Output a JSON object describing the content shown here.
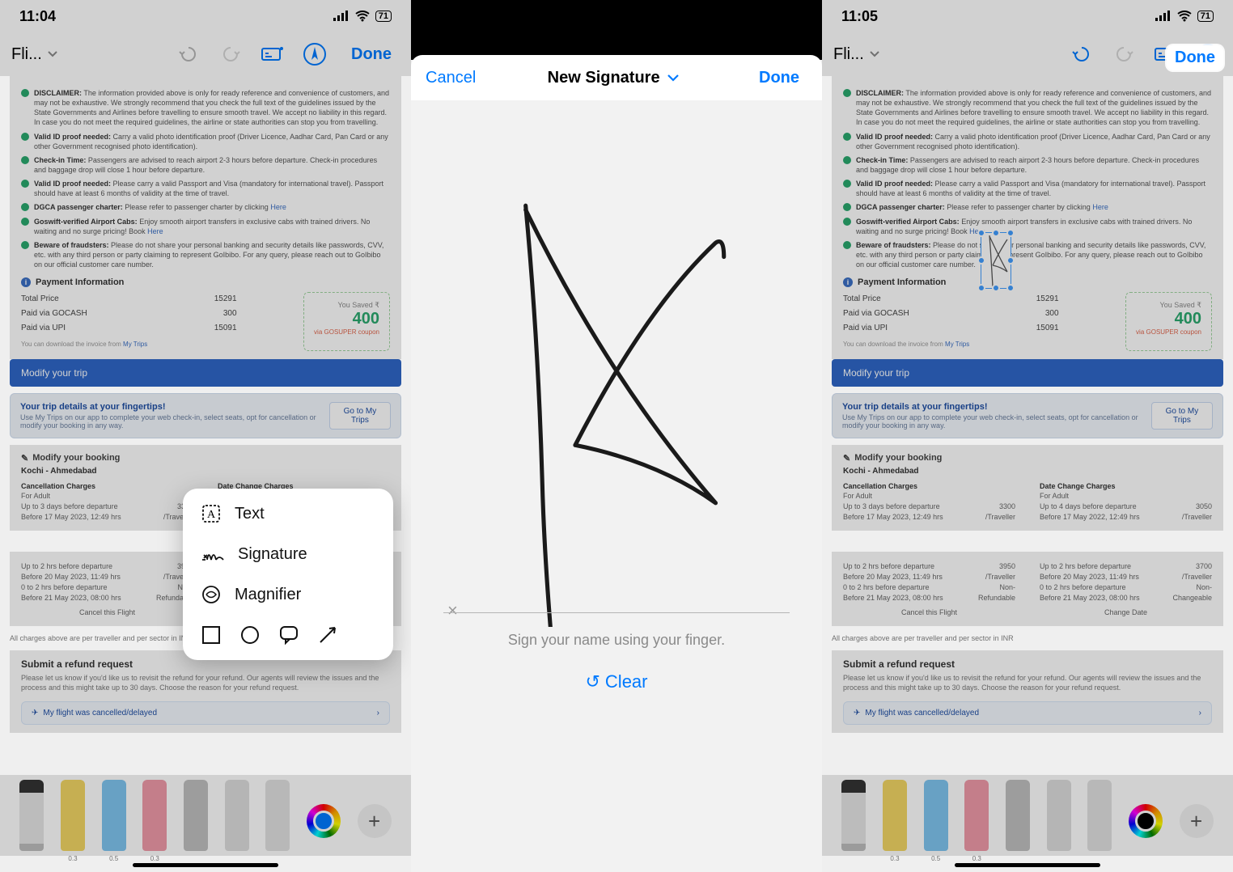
{
  "screen1": {
    "time": "11:04",
    "battery": "71",
    "file_title": "Fli...",
    "done": "Done",
    "doc": {
      "b1_t": "DISCLAIMER:",
      "b1": "The information provided above is only for ready reference and convenience of customers, and may not be exhaustive. We strongly recommend that you check the full text of the guidelines issued by the State Governments and Airlines before travelling to ensure smooth travel. We accept no liability in this regard. In case you do not meet the required guidelines, the airline or state authorities can stop you from travelling.",
      "b2_t": "Valid ID proof needed:",
      "b2": "Carry a valid photo identification proof (Driver Licence, Aadhar Card, Pan Card or any other Government recognised photo identification).",
      "b3_t": "Check-in Time:",
      "b3": "Passengers are advised to reach airport 2-3 hours before departure. Check-in procedures and baggage drop will close 1 hour before departure.",
      "b4_t": "Valid ID proof needed:",
      "b4": "Please carry a valid Passport and Visa (mandatory for international travel). Passport should have at least 6 months of validity at the time of travel.",
      "b5_t": "DGCA passenger charter:",
      "b5": "Please refer to passenger charter by clicking",
      "b5l": "Here",
      "b6_t": "Goswift-verified Airport Cabs:",
      "b6": "Enjoy smooth airport transfers in exclusive cabs with trained drivers. No waiting and no surge pricing! Book",
      "b6l": "Here",
      "b7_t": "Beware of fraudsters:",
      "b7": "Please do not share your personal banking and security details like passwords, CVV, etc. with any third person or party claiming to represent GoIbibo. For any query, please reach out to GoIbibo on our official customer care number."
    },
    "pay_header": "Payment Information",
    "pay_l1": "Total Price",
    "pay_v1": "15291",
    "pay_l2": "Paid via GOCASH",
    "pay_v2": "300",
    "pay_l3": "Paid via UPI",
    "pay_v3": "15091",
    "pay_note": "You can download the invoice from",
    "pay_note_l": "My Trips",
    "coupon_label": "You Saved ₹",
    "coupon_amt": "400",
    "coupon_sub": "via GOSUPER coupon",
    "modify": "Modify your trip",
    "trip_t": "Your trip details at your fingertips!",
    "trip_s": "Use My Trips on our app to complete your web check-in, select seats, opt for cancellation or modify your booking in any way.",
    "trip_btn": "Go to My Trips",
    "book_h": "Modify your booking",
    "route": "Kochi - Ahmedabad",
    "col1_h": "Cancellation Charges",
    "col1_a": "For Adult",
    "col2_h": "Date Change Charges",
    "col2_a": "For Adult",
    "row_a1": "Up to 3 days before departure",
    "row_a1v": "3300",
    "row_a2": "Before 17 May 2023, 12:49 hrs",
    "row_a2v": "/Traveller",
    "row_b1": "Up to 4 days before departure",
    "row_b1v": "3050",
    "row_b2": "Before 17 May 2022, 12:49 hrs",
    "row_b2v": "/Traveller",
    "sec2_a1": "Up to 2 hrs before departure",
    "sec2_a1v": "3950",
    "sec2_a2": "Before 20 May 2023, 11:49 hrs",
    "sec2_a2v": "/Traveller",
    "sec2_a3": "0 to 2 hrs before departure",
    "sec2_a3v": "Non-",
    "sec2_a4": "Before 21 May 2023, 08:00 hrs",
    "sec2_a4v": "Refundable",
    "sec2_b1": "Up to 2 hrs before departure",
    "sec2_b1v": "3700",
    "sec2_b2": "Before 20 May 2023, 11:49 hrs",
    "sec2_b2v": "/Traveller",
    "sec2_b3": "0 to 2 hrs before departure",
    "sec2_b3v": "Non-",
    "sec2_b4": "Before 21 May 2023, 08:00 hrs",
    "sec2_b4v": "Changeable",
    "act1": "Cancel this Flight",
    "act2": "Change Date",
    "note": "All charges above are per traveller and per sector in INR",
    "refund_h": "Submit a refund request",
    "refund_d": "Please let us know if you'd like us to revisit the refund for your refund. Our agents will review the issues and the process and this might take up to 30 days. Choose the reason for your refund request.",
    "refund_chip": "My flight was cancelled/delayed",
    "menu": {
      "text": "Text",
      "signature": "Signature",
      "magnifier": "Magnifier"
    }
  },
  "screen2": {
    "cancel": "Cancel",
    "title": "New Signature",
    "done": "Done",
    "hint": "Sign your name using your finger.",
    "clear": "Clear"
  },
  "screen3": {
    "time": "11:05",
    "battery": "71",
    "done": "Done"
  },
  "tools": {
    "m1": "0.3",
    "m2": "0.5",
    "m3": "0.3"
  }
}
